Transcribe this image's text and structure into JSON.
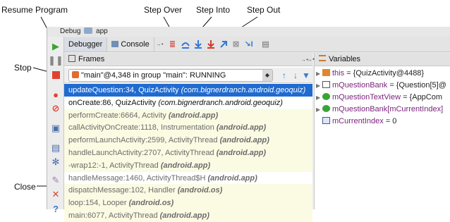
{
  "callouts": {
    "resume": "Resume Program",
    "stop": "Stop",
    "close": "Close",
    "step_over": "Step Over",
    "step_into": "Step Into",
    "step_out": "Step Out"
  },
  "window": {
    "title_prefix": "Debug",
    "title_app": "app"
  },
  "tabs": [
    {
      "label": "Debugger",
      "active": true
    },
    {
      "label": "Console",
      "active": false
    }
  ],
  "frames_panel": {
    "title": "Frames",
    "thread_label": "\"main\"@4,348 in group \"main\": RUNNING"
  },
  "frames": [
    {
      "method": "updateQuestion:34, QuizActivity",
      "pkg": "(com.bignerdranch.android.geoquiz)",
      "kind": "selected"
    },
    {
      "method": "onCreate:86, QuizActivity",
      "pkg": "(com.bignerdranch.android.geoquiz)",
      "kind": "app"
    },
    {
      "method": "performCreate:6664, Activity",
      "pkg": "(android.app)",
      "kind": "lib"
    },
    {
      "method": "callActivityOnCreate:1118, Instrumentation",
      "pkg": "(android.app)",
      "kind": "lib"
    },
    {
      "method": "performLaunchActivity:2599, ActivityThread",
      "pkg": "(android.app)",
      "kind": "lib"
    },
    {
      "method": "handleLaunchActivity:2707, ActivityThread",
      "pkg": "(android.app)",
      "kind": "lib"
    },
    {
      "method": "-wrap12:-1, ActivityThread",
      "pkg": "(android.app)",
      "kind": "lib"
    },
    {
      "method": "handleMessage:1460, ActivityThread$H",
      "pkg": "(android.app)",
      "kind": "other"
    },
    {
      "method": "dispatchMessage:102, Handler",
      "pkg": "(android.os)",
      "kind": "lib"
    },
    {
      "method": "loop:154, Looper",
      "pkg": "(android.os)",
      "kind": "lib"
    },
    {
      "method": "main:6077, ActivityThread",
      "pkg": "(android.app)",
      "kind": "lib"
    }
  ],
  "variables_panel": {
    "title": "Variables"
  },
  "variables": [
    {
      "name": "this",
      "value": " = {QuizActivity@4488}",
      "icon": "object",
      "expandable": true
    },
    {
      "name": "mQuestionBank",
      "value": " = {Question[5]@",
      "icon": "array",
      "expandable": true
    },
    {
      "name": "mQuestionTextView",
      "value": " = {AppCom",
      "icon": "field",
      "expandable": true
    },
    {
      "name": "mQuestionBank[mCurrentIndex]",
      "value": "",
      "icon": "field",
      "expandable": true
    },
    {
      "name": "mCurrentIndex",
      "value": " = 0",
      "icon": "primitive",
      "expandable": false
    }
  ],
  "colors": {
    "selected": "#1f6bd0",
    "resume_green": "#3aa335",
    "stop_red": "#e0422f",
    "step_blue": "#2f7ad6"
  }
}
